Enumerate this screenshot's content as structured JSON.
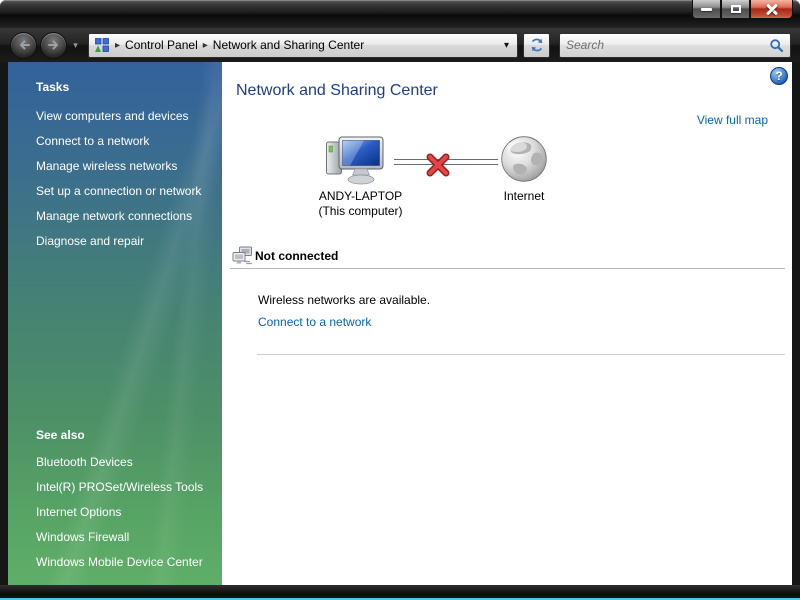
{
  "navbar": {
    "breadcrumb": {
      "items": [
        "Control Panel",
        "Network and Sharing Center"
      ]
    },
    "search": {
      "placeholder": "Search",
      "value": ""
    }
  },
  "sidebar": {
    "tasks_header": "Tasks",
    "tasks": [
      "View computers and devices",
      "Connect to a network",
      "Manage wireless networks",
      "Set up a connection or network",
      "Manage network connections",
      "Diagnose and repair"
    ],
    "see_also_header": "See also",
    "see_also": [
      "Bluetooth Devices",
      "Intel(R) PROSet/Wireless Tools",
      "Internet Options",
      "Windows Firewall",
      "Windows Mobile Device Center"
    ]
  },
  "main": {
    "title": "Network and Sharing Center",
    "view_full_map": "View full map",
    "map": {
      "computer_name": "ANDY-LAPTOP",
      "computer_sub": "(This computer)",
      "internet_label": "Internet"
    },
    "status": {
      "heading": "Not connected",
      "message": "Wireless networks are available.",
      "action": "Connect to a network"
    }
  },
  "icons": {
    "breadcrumb_separator": "▸",
    "breadcrumb_dropdown": "▾",
    "nav_history_dropdown": "▾",
    "help_glyph": "?"
  },
  "colors": {
    "title_text": "#1e3c94",
    "link": "#0661bf",
    "sidebar_top": "#33619b",
    "sidebar_middle": "#458175",
    "sidebar_bottom": "#58a565",
    "close_button_red": "#b02716",
    "error_x_red": "#cc3333",
    "window_frame": "#1c1c1c",
    "connection_line": "#5f6f7e"
  }
}
